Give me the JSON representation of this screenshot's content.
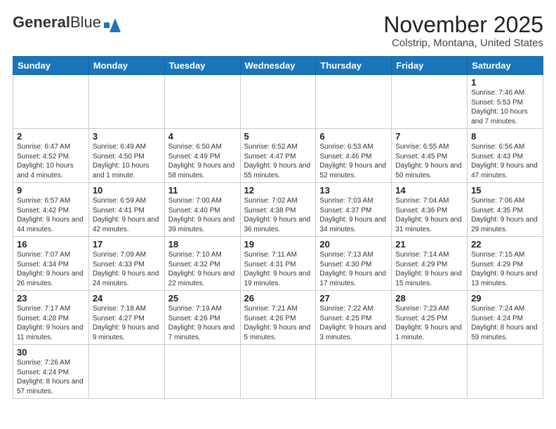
{
  "header": {
    "logo_general": "General",
    "logo_blue": "Blue",
    "month_title": "November 2025",
    "location": "Colstrip, Montana, United States"
  },
  "weekdays": [
    "Sunday",
    "Monday",
    "Tuesday",
    "Wednesday",
    "Thursday",
    "Friday",
    "Saturday"
  ],
  "weeks": [
    [
      {
        "day": "",
        "info": ""
      },
      {
        "day": "",
        "info": ""
      },
      {
        "day": "",
        "info": ""
      },
      {
        "day": "",
        "info": ""
      },
      {
        "day": "",
        "info": ""
      },
      {
        "day": "",
        "info": ""
      },
      {
        "day": "1",
        "info": "Sunrise: 7:46 AM\nSunset: 5:53 PM\nDaylight: 10 hours and 7 minutes."
      }
    ],
    [
      {
        "day": "2",
        "info": "Sunrise: 6:47 AM\nSunset: 4:52 PM\nDaylight: 10 hours and 4 minutes."
      },
      {
        "day": "3",
        "info": "Sunrise: 6:49 AM\nSunset: 4:50 PM\nDaylight: 10 hours and 1 minute."
      },
      {
        "day": "4",
        "info": "Sunrise: 6:50 AM\nSunset: 4:49 PM\nDaylight: 9 hours and 58 minutes."
      },
      {
        "day": "5",
        "info": "Sunrise: 6:52 AM\nSunset: 4:47 PM\nDaylight: 9 hours and 55 minutes."
      },
      {
        "day": "6",
        "info": "Sunrise: 6:53 AM\nSunset: 4:46 PM\nDaylight: 9 hours and 52 minutes."
      },
      {
        "day": "7",
        "info": "Sunrise: 6:55 AM\nSunset: 4:45 PM\nDaylight: 9 hours and 50 minutes."
      },
      {
        "day": "8",
        "info": "Sunrise: 6:56 AM\nSunset: 4:43 PM\nDaylight: 9 hours and 47 minutes."
      }
    ],
    [
      {
        "day": "9",
        "info": "Sunrise: 6:57 AM\nSunset: 4:42 PM\nDaylight: 9 hours and 44 minutes."
      },
      {
        "day": "10",
        "info": "Sunrise: 6:59 AM\nSunset: 4:41 PM\nDaylight: 9 hours and 42 minutes."
      },
      {
        "day": "11",
        "info": "Sunrise: 7:00 AM\nSunset: 4:40 PM\nDaylight: 9 hours and 39 minutes."
      },
      {
        "day": "12",
        "info": "Sunrise: 7:02 AM\nSunset: 4:38 PM\nDaylight: 9 hours and 36 minutes."
      },
      {
        "day": "13",
        "info": "Sunrise: 7:03 AM\nSunset: 4:37 PM\nDaylight: 9 hours and 34 minutes."
      },
      {
        "day": "14",
        "info": "Sunrise: 7:04 AM\nSunset: 4:36 PM\nDaylight: 9 hours and 31 minutes."
      },
      {
        "day": "15",
        "info": "Sunrise: 7:06 AM\nSunset: 4:35 PM\nDaylight: 9 hours and 29 minutes."
      }
    ],
    [
      {
        "day": "16",
        "info": "Sunrise: 7:07 AM\nSunset: 4:34 PM\nDaylight: 9 hours and 26 minutes."
      },
      {
        "day": "17",
        "info": "Sunrise: 7:09 AM\nSunset: 4:33 PM\nDaylight: 9 hours and 24 minutes."
      },
      {
        "day": "18",
        "info": "Sunrise: 7:10 AM\nSunset: 4:32 PM\nDaylight: 9 hours and 22 minutes."
      },
      {
        "day": "19",
        "info": "Sunrise: 7:11 AM\nSunset: 4:31 PM\nDaylight: 9 hours and 19 minutes."
      },
      {
        "day": "20",
        "info": "Sunrise: 7:13 AM\nSunset: 4:30 PM\nDaylight: 9 hours and 17 minutes."
      },
      {
        "day": "21",
        "info": "Sunrise: 7:14 AM\nSunset: 4:29 PM\nDaylight: 9 hours and 15 minutes."
      },
      {
        "day": "22",
        "info": "Sunrise: 7:15 AM\nSunset: 4:29 PM\nDaylight: 9 hours and 13 minutes."
      }
    ],
    [
      {
        "day": "23",
        "info": "Sunrise: 7:17 AM\nSunset: 4:28 PM\nDaylight: 9 hours and 11 minutes."
      },
      {
        "day": "24",
        "info": "Sunrise: 7:18 AM\nSunset: 4:27 PM\nDaylight: 9 hours and 9 minutes."
      },
      {
        "day": "25",
        "info": "Sunrise: 7:19 AM\nSunset: 4:26 PM\nDaylight: 9 hours and 7 minutes."
      },
      {
        "day": "26",
        "info": "Sunrise: 7:21 AM\nSunset: 4:26 PM\nDaylight: 9 hours and 5 minutes."
      },
      {
        "day": "27",
        "info": "Sunrise: 7:22 AM\nSunset: 4:25 PM\nDaylight: 9 hours and 3 minutes."
      },
      {
        "day": "28",
        "info": "Sunrise: 7:23 AM\nSunset: 4:25 PM\nDaylight: 9 hours and 1 minute."
      },
      {
        "day": "29",
        "info": "Sunrise: 7:24 AM\nSunset: 4:24 PM\nDaylight: 8 hours and 59 minutes."
      }
    ],
    [
      {
        "day": "30",
        "info": "Sunrise: 7:26 AM\nSunset: 4:24 PM\nDaylight: 8 hours and 57 minutes."
      },
      {
        "day": "",
        "info": ""
      },
      {
        "day": "",
        "info": ""
      },
      {
        "day": "",
        "info": ""
      },
      {
        "day": "",
        "info": ""
      },
      {
        "day": "",
        "info": ""
      },
      {
        "day": "",
        "info": ""
      }
    ]
  ]
}
